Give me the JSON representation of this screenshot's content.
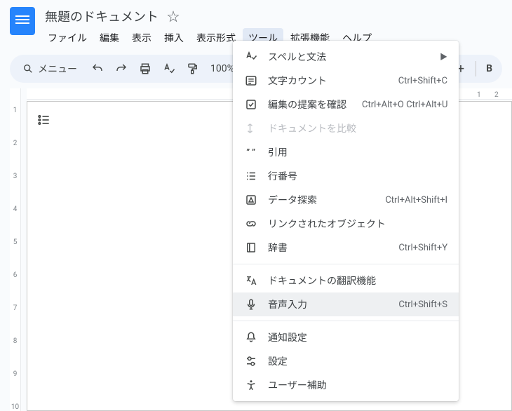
{
  "header": {
    "doc_title": "無題のドキュメント",
    "menubar": [
      "ファイル",
      "編集",
      "表示",
      "挿入",
      "表示形式",
      "ツール",
      "拡張機能",
      "ヘルプ"
    ],
    "open_menu_index": 5
  },
  "toolbar": {
    "search_label": "メニュー",
    "zoom": "100%",
    "plus": "+",
    "bold": "B"
  },
  "ruler": {
    "h_marks": [
      "1",
      "2"
    ],
    "v_marks": [
      "1",
      "2",
      "3",
      "4",
      "5",
      "6",
      "7",
      "8",
      "9",
      "10"
    ]
  },
  "tools_menu": [
    {
      "type": "item",
      "icon": "spellcheck",
      "label": "スペルと文法",
      "submenu": true
    },
    {
      "type": "item",
      "icon": "wordcount",
      "label": "文字カウント",
      "shortcut": "Ctrl+Shift+C"
    },
    {
      "type": "item",
      "icon": "review",
      "label": "編集の提案を確認",
      "shortcut": "Ctrl+Alt+O Ctrl+Alt+U"
    },
    {
      "type": "item",
      "icon": "compare",
      "label": "ドキュメントを比較",
      "disabled": true
    },
    {
      "type": "item",
      "icon": "citation",
      "label": "引用"
    },
    {
      "type": "item",
      "icon": "linenum",
      "label": "行番号"
    },
    {
      "type": "item",
      "icon": "explore",
      "label": "データ探索",
      "shortcut": "Ctrl+Alt+Shift+I"
    },
    {
      "type": "item",
      "icon": "linked",
      "label": "リンクされたオブジェクト"
    },
    {
      "type": "item",
      "icon": "dictionary",
      "label": "辞書",
      "shortcut": "Ctrl+Shift+Y"
    },
    {
      "type": "sep"
    },
    {
      "type": "item",
      "icon": "translate",
      "label": "ドキュメントの翻訳機能"
    },
    {
      "type": "item",
      "icon": "voice",
      "label": "音声入力",
      "shortcut": "Ctrl+Shift+S",
      "highlight": true
    },
    {
      "type": "sep"
    },
    {
      "type": "item",
      "icon": "notify",
      "label": "通知設定"
    },
    {
      "type": "item",
      "icon": "prefs",
      "label": "設定"
    },
    {
      "type": "item",
      "icon": "a11y",
      "label": "ユーザー補助"
    }
  ]
}
